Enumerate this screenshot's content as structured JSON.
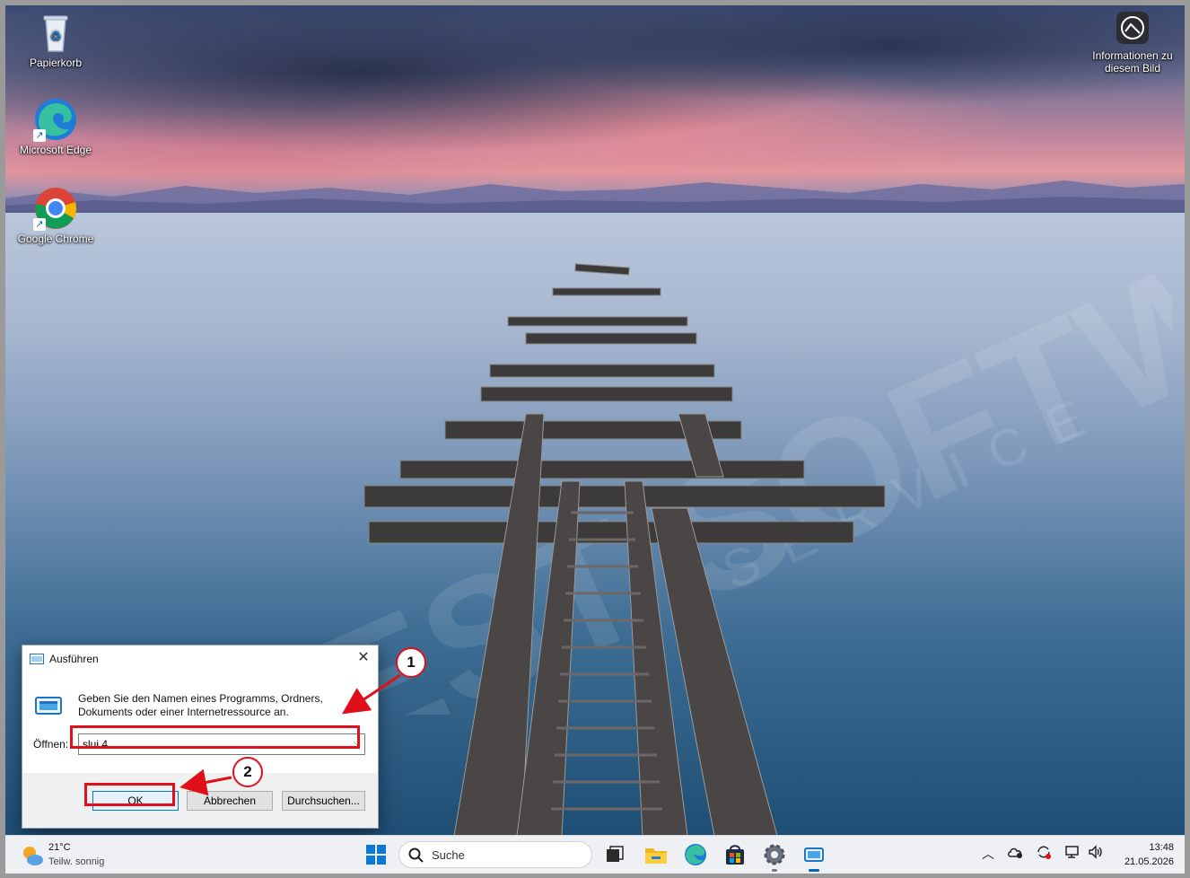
{
  "desktop": {
    "icons": [
      {
        "label": "Papierkorb",
        "icon": "recycle-bin-icon"
      },
      {
        "label": "Microsoft Edge",
        "icon": "edge-icon"
      },
      {
        "label": "Google Chrome",
        "icon": "chrome-icon"
      }
    ],
    "info_icon": {
      "label": "Informationen zu diesem Bild",
      "icon": "camera-aperture-icon"
    },
    "watermark": "BEST SOFTWARE SERVICE"
  },
  "run_dialog": {
    "title": "Ausführen",
    "description": "Geben Sie den Namen eines Programms, Ordners, Dokuments oder einer Internetressource an.",
    "open_label": "Öffnen:",
    "open_value": "slui 4",
    "ok_label": "OK",
    "cancel_label": "Abbrechen",
    "browse_label": "Durchsuchen...",
    "close_glyph": "✕"
  },
  "annotations": {
    "step1": "1",
    "step2": "2",
    "color": "#e0101a"
  },
  "taskbar": {
    "weather_temp": "21°C",
    "weather_cond": "Teilw. sonnig",
    "search_label": "Suche",
    "apps": [
      "windows-start-icon",
      "task-view-icon",
      "file-explorer-icon",
      "edge-icon",
      "store-icon",
      "settings-icon",
      "run-app-icon"
    ],
    "tray": [
      "chevron-up-icon",
      "cloud-icon",
      "sync-icon",
      "network-icon",
      "volume-icon"
    ],
    "time": "13:48",
    "date": "21.05.2026",
    "accent": "#0067c0"
  }
}
